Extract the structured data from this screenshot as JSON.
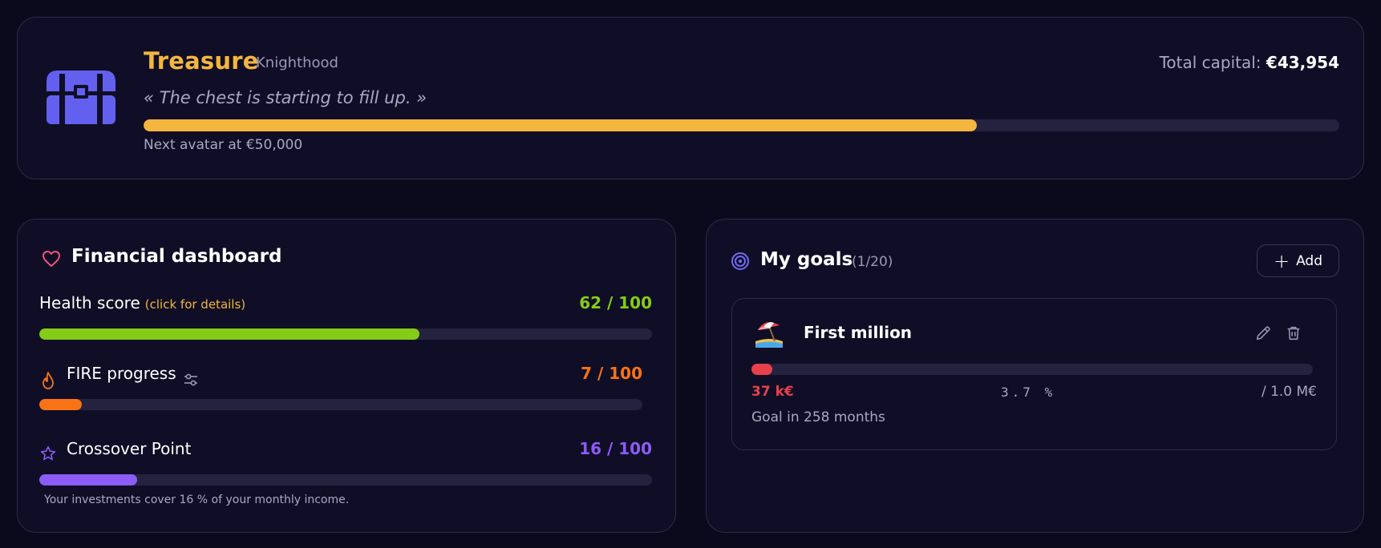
{
  "treasure": {
    "title": "Treasure",
    "rank": "Knighthood",
    "quote": "« The chest is starting to fill up. »",
    "capital_label": "Total capital:",
    "capital_value": "€43,954",
    "progress": 0.697,
    "next_avatar": "Next avatar at €50,000",
    "icon": "treasure-chest-icon",
    "color": "#f4b63f",
    "icon_color": "#6360f0"
  },
  "dashboard": {
    "title": "Financial dashboard",
    "icon": "heart-icon",
    "metrics": [
      {
        "label": "Health score",
        "hint": "(click for details)",
        "score": "62 / 100",
        "value": 62,
        "color": "#84cc16"
      },
      {
        "label": "FIRE progress",
        "score": "7 / 100",
        "value": 7,
        "color": "#f97316",
        "icon": "fire-icon",
        "settings_icon": "sliders-icon"
      },
      {
        "label": "Crossover Point",
        "score": "16 / 100",
        "value": 16,
        "color": "#8b5cf6",
        "icon": "star-icon"
      }
    ],
    "crossover_note": "Your investments cover 16 % of your monthly income."
  },
  "goals": {
    "title": "My goals",
    "count": "(1/20)",
    "add_label": "Add",
    "icon": "target-icon",
    "items": [
      {
        "name": "First million",
        "emoji": "beach-umbrella-icon",
        "current": "37 k€",
        "percent_text": "3.7 %",
        "percent": 3.7,
        "target": "/ 1.0 M€",
        "eta": "Goal in 258 months",
        "color": "#e8414c"
      }
    ]
  }
}
